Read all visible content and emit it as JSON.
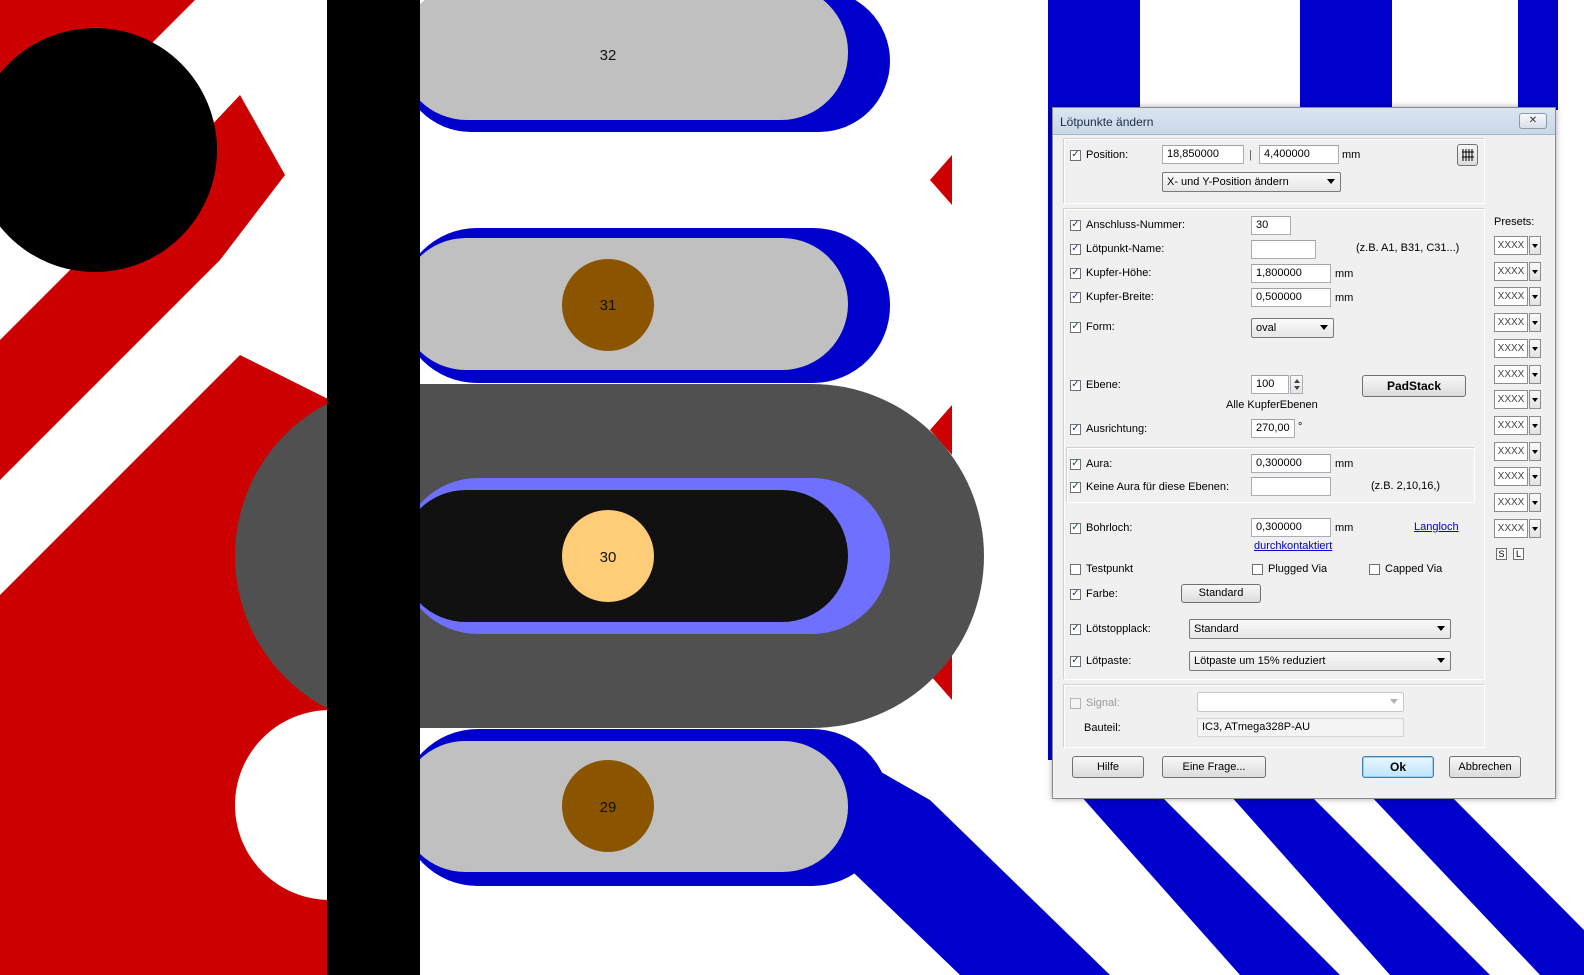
{
  "canvas": {
    "pads": [
      {
        "number": "32"
      },
      {
        "number": "31"
      },
      {
        "number": "30"
      },
      {
        "number": "29"
      }
    ],
    "colors": {
      "background": "#ffffff",
      "red_layer": "#cc0000",
      "blue_layer": "#0000cc",
      "pad_gray": "#c0c0c0",
      "selected_aura": "#505050",
      "selected_pad": "#111111",
      "selected_outline": "#7070ff",
      "drill_brown": "#8b5500",
      "drill_selected": "#ffcc77",
      "black_track": "#000000"
    }
  },
  "dialog": {
    "title": "Lötpunkte ändern",
    "close_label": "✕",
    "position": {
      "label": "Position:",
      "x_value": "18,850000",
      "separator": "|",
      "y_value": "4,400000",
      "unit": "mm",
      "mode_select": "X- und Y-Position ändern"
    },
    "props": {
      "pin_number": {
        "label": "Anschluss-Nummer:",
        "value": "30"
      },
      "pad_name": {
        "label": "Lötpunkt-Name:",
        "value": "",
        "hint": "(z.B. A1, B31, C31...)"
      },
      "copper_height": {
        "label": "Kupfer-Höhe:",
        "value": "1,800000",
        "unit": "mm"
      },
      "copper_width": {
        "label": "Kupfer-Breite:",
        "value": "0,500000",
        "unit": "mm"
      },
      "shape": {
        "label": "Form:",
        "value": "oval"
      },
      "layer": {
        "label": "Ebene:",
        "value": "100",
        "sub": "Alle KupferEbenen"
      },
      "padstack_button": "PadStack",
      "orientation": {
        "label": "Ausrichtung:",
        "value": "270,00",
        "unit": "°"
      },
      "aura": {
        "label": "Aura:",
        "value": "0,300000",
        "unit": "mm"
      },
      "no_aura": {
        "label": "Keine Aura für diese Ebenen:",
        "value": "",
        "hint": "(z.B. 2,10,16,)"
      },
      "drill": {
        "label": "Bohrloch:",
        "value": "0,300000",
        "unit": "mm",
        "link": "Langloch",
        "plated_link": "durchkontaktiert"
      },
      "testpoint": {
        "label": "Testpunkt"
      },
      "plugged_via": {
        "label": "Plugged Via"
      },
      "capped_via": {
        "label": "Capped Via"
      },
      "color": {
        "label": "Farbe:",
        "button": "Standard"
      },
      "solder_mask": {
        "label": "Lötstopplack:",
        "value": "Standard"
      },
      "solder_paste": {
        "label": "Lötpaste:",
        "value": "Lötpaste um 15% reduziert"
      }
    },
    "signal": {
      "label": "Signal:",
      "value": "",
      "component_label": "Bauteil:",
      "component_value": "IC3, ATmega328P-AU"
    },
    "presets": {
      "label": "Presets:",
      "items": [
        "XXXX",
        "XXXX",
        "XXXX",
        "XXXX",
        "XXXX",
        "XXXX",
        "XXXX",
        "XXXX",
        "XXXX",
        "XXXX",
        "XXXX",
        "XXXX"
      ],
      "s_label": "S",
      "l_label": "L"
    },
    "check_glyph": "✓",
    "buttons": {
      "help": "Hilfe",
      "question": "Eine Frage...",
      "ok": "Ok",
      "cancel": "Abbrechen"
    }
  }
}
